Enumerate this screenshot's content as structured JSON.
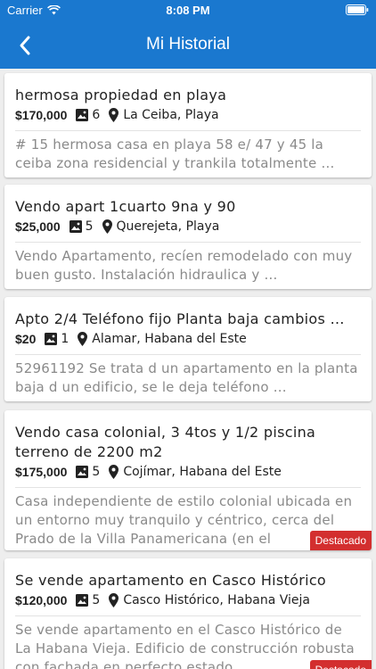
{
  "status": {
    "carrier": "Carrier",
    "time": "8:08 PM"
  },
  "nav": {
    "title": "Mi Historial",
    "back_icon": "chevron-left-icon"
  },
  "colors": {
    "primary": "#1a78cf",
    "badge": "#d32f2f",
    "description": "#8a8a8a"
  },
  "listings": [
    {
      "title": "hermosa propiedad en playa",
      "price": "$170,000",
      "photos": "6",
      "location": "La Ceiba, Playa",
      "description": "# 15 hermosa casa en playa 58 e/ 47 y 45 la ceiba zona residencial y trankila totalmente …",
      "badge": ""
    },
    {
      "title": "Vendo apart 1cuarto 9na y 90",
      "price": "$25,000",
      "photos": "5",
      "location": "Querejeta, Playa",
      "description": "Vendo Apartamento, recíen remodelado con muy buen gusto. Instalación hidraulica y …",
      "badge": ""
    },
    {
      "title": "Apto 2/4 Teléfono fijo Planta baja cambios …",
      "price": "$20",
      "photos": "1",
      "location": "Alamar, Habana del Este",
      "description": "52961192 Se trata d un apartamento en la planta baja d un edificio, se le deja teléfono …",
      "badge": ""
    },
    {
      "title": "Vendo casa colonial, 3 4tos y 1/2 piscina terreno de 2200 m2",
      "price": "$175,000",
      "photos": "5",
      "location": "Cojímar, Habana del Este",
      "description": "Casa independiente de estilo colonial ubicada en un entorno muy tranquilo y céntrico, cerca del Prado de la Villa Panamericana (en el",
      "badge": "Destacado"
    },
    {
      "title": "Se vende apartamento en Casco Histórico",
      "price": "$120,000",
      "photos": "5",
      "location": "Casco Histórico, Habana Vieja",
      "description": "Se vende apartamento en el Casco Histórico de La Habana Vieja. Edificio de construcción robusta con fachada en perfecto estado",
      "badge": "Destacado"
    }
  ]
}
